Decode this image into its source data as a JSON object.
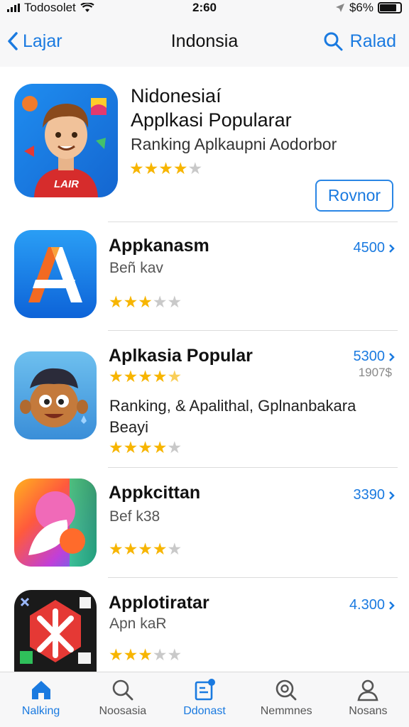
{
  "status": {
    "carrier": "Todosolet",
    "time": "2:60",
    "battery": "$6%"
  },
  "nav": {
    "back_label": "Lajar",
    "title": "Indonsia",
    "search_label": "Ralad"
  },
  "featured": {
    "title_line1": "Nidonesiaí",
    "title_line2": "Applkasi Popularar",
    "subtitle": "Ranking Aplkaupni Aodorbor",
    "rating": 4,
    "button_label": "Rovnor"
  },
  "apps": [
    {
      "title": "Appkanasm",
      "subtitle": "Beñ kav",
      "price": "4500",
      "rating": 3
    },
    {
      "title": "Aplkasia Popular",
      "price": "5300",
      "price2": "1907$",
      "rating_top": 4.5,
      "description": "Ranking, & Apalithal, Gplnanbakara Beayi",
      "rating": 4
    },
    {
      "title": "Appkcittan",
      "subtitle": "Bef k38",
      "price": "3390",
      "rating": 4
    },
    {
      "title": "Applotiratar",
      "subtitle": "Apn kaR",
      "price": "4.300",
      "rating": 3
    }
  ],
  "tabs": [
    {
      "label": "Nalking",
      "icon": "home-icon",
      "active": true
    },
    {
      "label": "Noosasia",
      "icon": "search-icon",
      "active": false
    },
    {
      "label": "Ddonast",
      "icon": "apps-badge-icon",
      "active": false
    },
    {
      "label": "Nemmnes",
      "icon": "magnifier-circle-icon",
      "active": false
    },
    {
      "label": "Nosans",
      "icon": "person-icon",
      "active": false
    }
  ],
  "colors": {
    "accent": "#1a7ae0",
    "star": "#f7b500"
  }
}
